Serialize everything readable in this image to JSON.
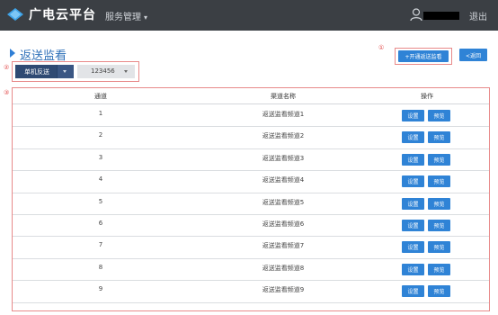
{
  "header": {
    "app_title": "广电云平台",
    "menu_label": "服务管理",
    "logout_label": "退出"
  },
  "page": {
    "title": "返送监看"
  },
  "markers": {
    "filters": "②",
    "add": "①",
    "table": "③"
  },
  "filters": {
    "mode_select": "单机反送",
    "channel_select": "123456"
  },
  "toolbar": {
    "add_label": "+开通返送监看",
    "back_label": "<返回"
  },
  "table": {
    "headers": [
      "通道",
      "渠道名称",
      "操作"
    ],
    "rows": [
      {
        "channel": "1",
        "name": "返送监看频道1",
        "set_label": "设置",
        "preview_label": "预览"
      },
      {
        "channel": "2",
        "name": "返送监看频道2",
        "set_label": "设置",
        "preview_label": "预览"
      },
      {
        "channel": "3",
        "name": "返送监看频道3",
        "set_label": "设置",
        "preview_label": "预览"
      },
      {
        "channel": "4",
        "name": "返送监看频道4",
        "set_label": "设置",
        "preview_label": "预览"
      },
      {
        "channel": "5",
        "name": "返送监看频道5",
        "set_label": "设置",
        "preview_label": "预览"
      },
      {
        "channel": "6",
        "name": "返送监看频道6",
        "set_label": "设置",
        "preview_label": "预览"
      },
      {
        "channel": "7",
        "name": "返送监看频道7",
        "set_label": "设置",
        "preview_label": "预览"
      },
      {
        "channel": "8",
        "name": "返送监看频道8",
        "set_label": "设置",
        "preview_label": "预览"
      },
      {
        "channel": "9",
        "name": "返送监看频道9",
        "set_label": "设置",
        "preview_label": "预览"
      }
    ]
  },
  "colors": {
    "topbar": "#3b3f44",
    "accent_blue": "#2f83d6",
    "annotation_red": "#e24b4b"
  }
}
